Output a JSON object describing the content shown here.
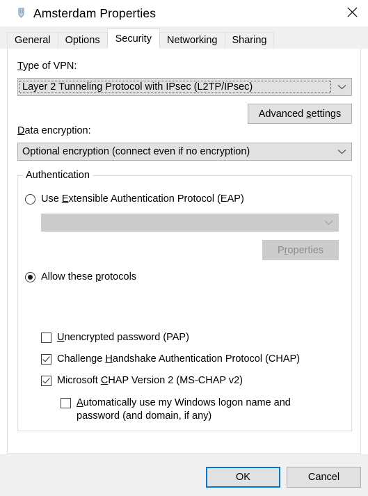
{
  "window": {
    "title": "Amsterdam Properties",
    "icon": "vpn-connection-icon",
    "close_label": "Close",
    "close_icon": "close-icon"
  },
  "tabs": [
    {
      "label": "General",
      "active": false
    },
    {
      "label": "Options",
      "active": false
    },
    {
      "label": "Security",
      "active": true
    },
    {
      "label": "Networking",
      "active": false
    },
    {
      "label": "Sharing",
      "active": false
    }
  ],
  "security": {
    "vpn_type": {
      "label": "Type of VPN:",
      "label_accesskey": "T",
      "value": "Layer 2 Tunneling Protocol with IPsec (L2TP/IPsec)",
      "focused": true
    },
    "advanced_settings_button": {
      "label_pre": "Advanced ",
      "label_key": "s",
      "label_post": "ettings"
    },
    "data_encryption": {
      "label": "Data encryption:",
      "label_accesskey": "D",
      "value": "Optional encryption (connect even if no encryption)"
    },
    "authentication": {
      "group_label": "Authentication",
      "eap_radio": {
        "label_pre": "Use ",
        "label_key": "E",
        "label_post": "xtensible Authentication Protocol (EAP)",
        "checked": false
      },
      "eap_combo": {
        "value": "",
        "disabled": true
      },
      "properties_button": {
        "label_pre": "P",
        "label_key": "r",
        "label_post": "operties",
        "disabled": true
      },
      "allow_protocols_radio": {
        "label_pre": "Allow these ",
        "label_key": "p",
        "label_post": "rotocols",
        "checked": true
      },
      "protocols": [
        {
          "label_pre": "",
          "label_key": "U",
          "label_post": "nencrypted password (PAP)",
          "checked": false,
          "indent": false
        },
        {
          "label_pre": "Challenge ",
          "label_key": "H",
          "label_post": "andshake Authentication Protocol (CHAP)",
          "checked": true,
          "indent": false
        },
        {
          "label_pre": "Microsoft ",
          "label_key": "C",
          "label_post": "HAP Version 2 (MS-CHAP v2)",
          "checked": true,
          "indent": false
        }
      ],
      "auto_logon": {
        "label_pre": "",
        "label_key": "A",
        "label_post": "utomatically use my Windows logon name and",
        "label_line2": "password (and domain, if any)",
        "checked": false
      }
    }
  },
  "footer": {
    "ok_label": "OK",
    "cancel_label": "Cancel"
  },
  "colors": {
    "accent": "#0078d7",
    "dialog_bg": "#f0f0f0",
    "content_bg": "#ffffff",
    "control_bg": "#e1e1e1",
    "disabled_bg": "#cccccc"
  }
}
